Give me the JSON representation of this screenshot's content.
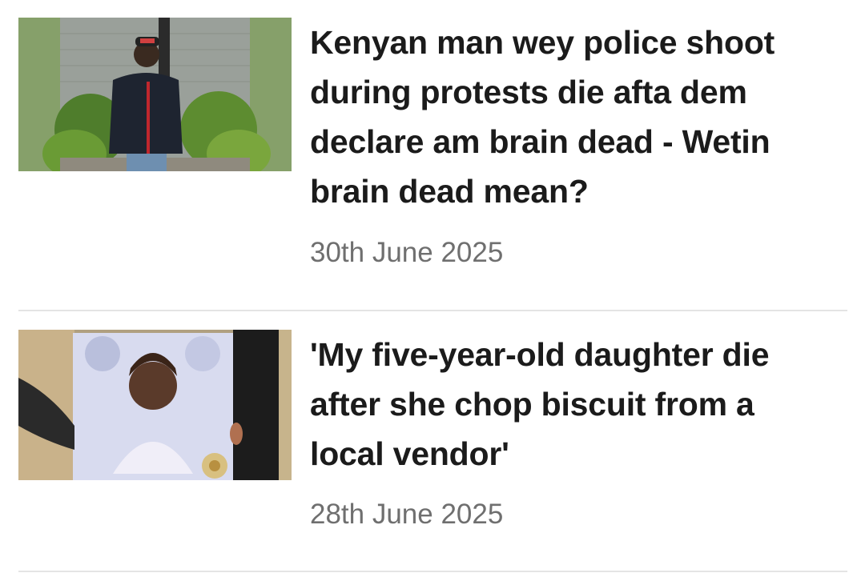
{
  "articles": [
    {
      "headline": "Kenyan man wey police shoot during protests die afta dem declare am brain dead - Wetin brain dead mean?",
      "date": "30th June 2025"
    },
    {
      "headline": "'My five-year-old daughter die after she chop biscuit from a local vendor'",
      "date": "28th June 2025"
    }
  ],
  "colors": {
    "headline": "#1b1b1b",
    "date": "#6f6f6f",
    "divider": "#e4e4e4"
  }
}
